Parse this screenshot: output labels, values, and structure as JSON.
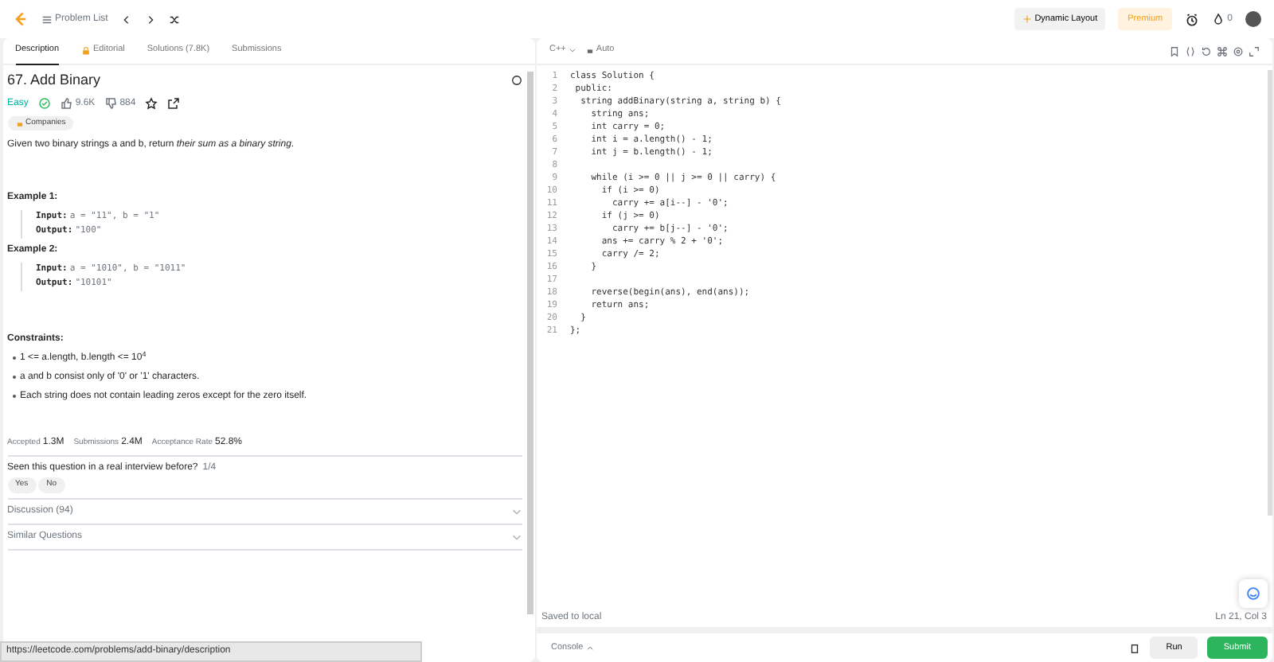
{
  "topbar": {
    "problem_list": "Problem List",
    "dynamic_layout": "Dynamic Layout",
    "premium": "Premium",
    "streak": "0"
  },
  "tabs": [
    {
      "label": "Description",
      "selected": true,
      "locked": false
    },
    {
      "label": "Editorial",
      "selected": false,
      "locked": true
    },
    {
      "label": "Solutions (7.8K)",
      "selected": false,
      "locked": false
    },
    {
      "label": "Submissions",
      "selected": false,
      "locked": false
    }
  ],
  "problem": {
    "title": "67. Add Binary",
    "difficulty": "Easy",
    "solved": true,
    "likes": "9.6K",
    "dislikes": "884",
    "companies": "Companies",
    "statement": "Given two binary strings a and b, return *their sum as a binary string*.",
    "examples": [
      {
        "heading": "Example 1:",
        "input_label": "Input:",
        "input": "a = \"11\", b = \"1\"",
        "output_label": "Output:",
        "output": "\"100\""
      },
      {
        "heading": "Example 2:",
        "input_label": "Input:",
        "input": "a = \"1010\", b = \"1011\"",
        "output_label": "Output:",
        "output": "\"10101\""
      }
    ],
    "constraints_heading": "Constraints:",
    "constraints": [
      "1 <= a.length, b.length <= 10$^{4}$",
      "a and b consist only of '0' or '1' characters.",
      "Each string does not contain leading zeros except for the zero itself."
    ],
    "stats": [
      {
        "label": "Accepted",
        "value": "1.3M"
      },
      {
        "label": "Submissions",
        "value": "2.4M"
      },
      {
        "label": "Acceptance Rate",
        "value": "52.8%"
      }
    ],
    "interview_question": "Seen this question in a real interview before?",
    "interview_count": "1/4",
    "answers": [
      "Yes",
      "No"
    ],
    "sections": [
      {
        "label": "Discussion (94)",
        "expanded": false
      },
      {
        "label": "Similar Questions",
        "expanded": false
      }
    ]
  },
  "editor": {
    "language": "C++",
    "mode": "Auto",
    "lines": [
      {
        "number": "1",
        "code": "class Solution {"
      },
      {
        "number": "2",
        "code": " public:"
      },
      {
        "number": "3",
        "code": "  string addBinary(string a, string b) {"
      },
      {
        "number": "4",
        "code": "    string ans;"
      },
      {
        "number": "5",
        "code": "    int carry = 0;"
      },
      {
        "number": "6",
        "code": "    int i = a.length() - 1;"
      },
      {
        "number": "7",
        "code": "    int j = b.length() - 1;"
      },
      {
        "number": "8"
      },
      {
        "number": "9",
        "code": "    while (i >= 0 || j >= 0 || carry) {"
      },
      {
        "number": "10",
        "code": "      if (i >= 0)"
      },
      {
        "number": "11",
        "code": "        carry += a[i--] - '0';"
      },
      {
        "number": "12",
        "code": "      if (j >= 0)"
      },
      {
        "number": "13",
        "code": "        carry += b[j--] - '0';"
      },
      {
        "number": "14",
        "code": "      ans += carry % 2 + '0';"
      },
      {
        "number": "15",
        "code": "      carry /= 2;"
      },
      {
        "number": "16",
        "code": "    }"
      },
      {
        "number": "17"
      },
      {
        "number": "18",
        "code": "    reverse(begin(ans), end(ans));"
      },
      {
        "number": "19",
        "code": "    return ans;"
      },
      {
        "number": "20",
        "code": "  }"
      },
      {
        "number": "21",
        "code": "};"
      }
    ],
    "saved": "Saved to local",
    "cursor": "Ln 21, Col 3"
  },
  "bottom": {
    "console": "Console",
    "run": "Run",
    "submit": "Submit"
  },
  "status_url": "https://leetcode.com/problems/add-binary/description"
}
